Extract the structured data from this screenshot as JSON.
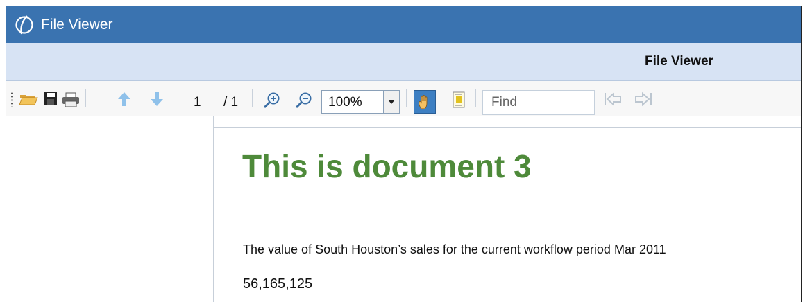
{
  "window": {
    "title": "File Viewer",
    "logo_icon": "ios-logo-icon"
  },
  "subheader": {
    "title": "File Viewer"
  },
  "toolbar": {
    "icons": [
      "open-folder-icon",
      "save-icon",
      "print-icon",
      "previous-page-icon",
      "next-page-icon",
      "zoom-in-icon",
      "zoom-out-icon",
      "hand-tool-icon",
      "text-select-icon",
      "find-previous-icon",
      "find-next-icon"
    ],
    "page_current": "1",
    "page_total": "/ 1",
    "zoom": {
      "value": "100%"
    },
    "find": {
      "placeholder": "Find"
    }
  },
  "document": {
    "title": "This is document 3",
    "paragraph": "The value of South Houston’s sales for the current workflow period Mar 2011",
    "value": "56,165,125"
  },
  "colors": {
    "titlebar": "#3a73b0",
    "subheader": "#d7e3f4",
    "doc_title": "#4e8a3a",
    "active_tool": "#3d7fc2"
  }
}
